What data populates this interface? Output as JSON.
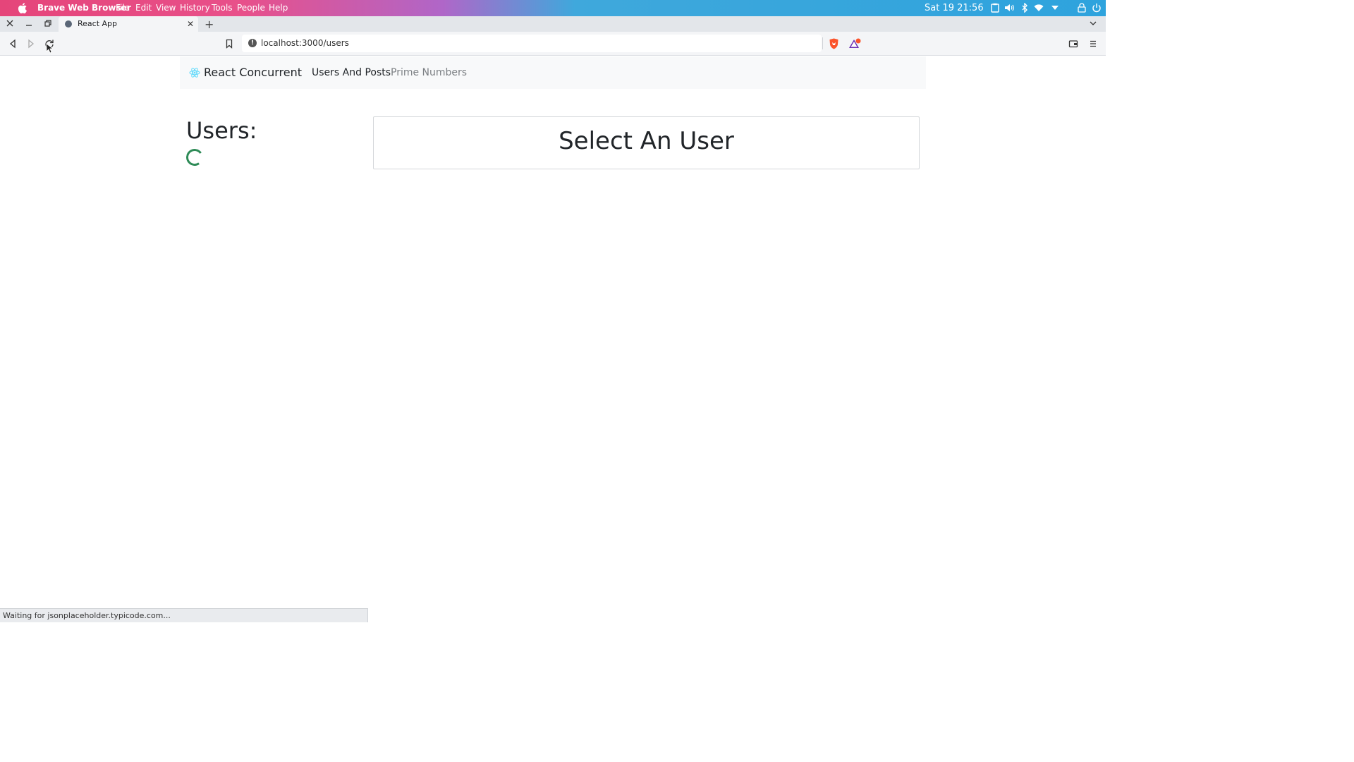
{
  "os_bar": {
    "app_name": "Brave Web Browser",
    "menus": [
      "File",
      "Edit",
      "View",
      "History",
      "Tools",
      "People",
      "Help"
    ],
    "clock": "Sat 19 21:56"
  },
  "tab": {
    "title": "React App",
    "close": "✕",
    "new_tab": "+"
  },
  "toolbar": {
    "url": "localhost:3000/users"
  },
  "navbar": {
    "brand": "React Concurrent",
    "links": [
      "Users And Posts",
      "Prime Numbers"
    ]
  },
  "main": {
    "users_heading": "Users:",
    "select_title": "Select An User"
  },
  "status": {
    "text": "Waiting for jsonplaceholder.typicode.com..."
  },
  "colors": {
    "spinner": "#2e8b57",
    "brave_lion": "#fb542b",
    "react_logo": "#61dafb"
  }
}
